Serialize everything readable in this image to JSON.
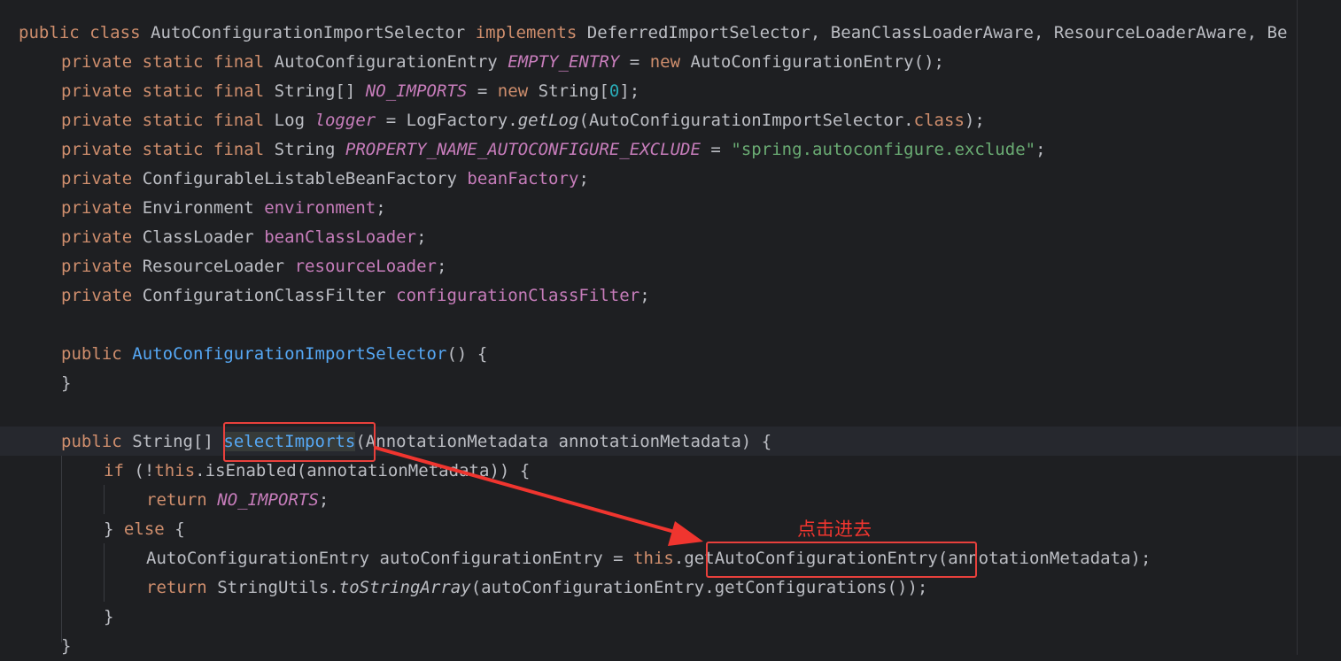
{
  "code": {
    "l1": {
      "public": "public",
      "class": "class",
      "name": "AutoConfigurationImportSelector",
      "implements": "implements",
      "ifaces": "DeferredImportSelector, BeanClassLoaderAware, ResourceLoaderAware, Be"
    },
    "l2": {
      "mods": "private static final",
      "type": "AutoConfigurationEntry",
      "field": "EMPTY_ENTRY",
      "eq": " = ",
      "new": "new",
      "rest": " AutoConfigurationEntry();"
    },
    "l3": {
      "mods": "private static final",
      "type": "String[]",
      "field": "NO_IMPORTS",
      "eq": " = ",
      "new": "new",
      "rest1": " String[",
      "num": "0",
      "rest2": "];"
    },
    "l4": {
      "mods": "private static final",
      "type": "Log",
      "field": "logger",
      "eq": " = LogFactory.",
      "method": "getLog",
      "arg": "(AutoConfigurationImportSelector.",
      "kw": "class",
      "end": ");"
    },
    "l5": {
      "mods": "private static final",
      "type": "String",
      "field": "PROPERTY_NAME_AUTOCONFIGURE_EXCLUDE",
      "eq": " = ",
      "str": "\"spring.autoconfigure.exclude\"",
      "end": ";"
    },
    "l6": {
      "mods": "private",
      "type": "ConfigurableListableBeanFactory",
      "field": "beanFactory",
      "end": ";"
    },
    "l7": {
      "mods": "private",
      "type": "Environment",
      "field": "environment",
      "end": ";"
    },
    "l8": {
      "mods": "private",
      "type": "ClassLoader",
      "field": "beanClassLoader",
      "end": ";"
    },
    "l9": {
      "mods": "private",
      "type": "ResourceLoader",
      "field": "resourceLoader",
      "end": ";"
    },
    "l10": {
      "mods": "private",
      "type": "ConfigurationClassFilter",
      "field": "configurationClassFilter",
      "end": ";"
    },
    "l12": {
      "mods": "public",
      "name": "AutoConfigurationImportSelector",
      "end": "() {"
    },
    "l13": {
      "text": "}"
    },
    "l15": {
      "mods": "public",
      "type": "String[]",
      "name": "selectImports",
      "end": "(AnnotationMetadata annotationMetadata) {"
    },
    "l16": {
      "if": "if",
      "p1": " (!",
      "this": "this",
      "rest": ".isEnabled(annotationMetadata)) {"
    },
    "l17": {
      "return": "return",
      "field": "NO_IMPORTS",
      "end": ";"
    },
    "l18": {
      "b": "} ",
      "else": "else",
      "end": " {"
    },
    "l19": {
      "pre": "AutoConfigurationEntry autoConfigurationEntry = ",
      "this": "this",
      "dot": ".",
      "call": "getAutoConfigurationEntry",
      "end": "(annotationMetadata);"
    },
    "l20": {
      "return": "return",
      "pre": " StringUtils.",
      "method": "toStringArray",
      "end": "(autoConfigurationEntry.getConfigurations());"
    },
    "l21": {
      "text": "}"
    },
    "l22": {
      "text": "}"
    }
  },
  "annotation": {
    "text": "点击进去",
    "color": "#f0352f"
  },
  "colors": {
    "background": "#1e1f22",
    "keyword": "#cf8e6d",
    "field": "#c77dbb",
    "string": "#6aab73",
    "number": "#2aacb8",
    "method_decl": "#56a8f5",
    "highlight_box": "#e8403c"
  }
}
